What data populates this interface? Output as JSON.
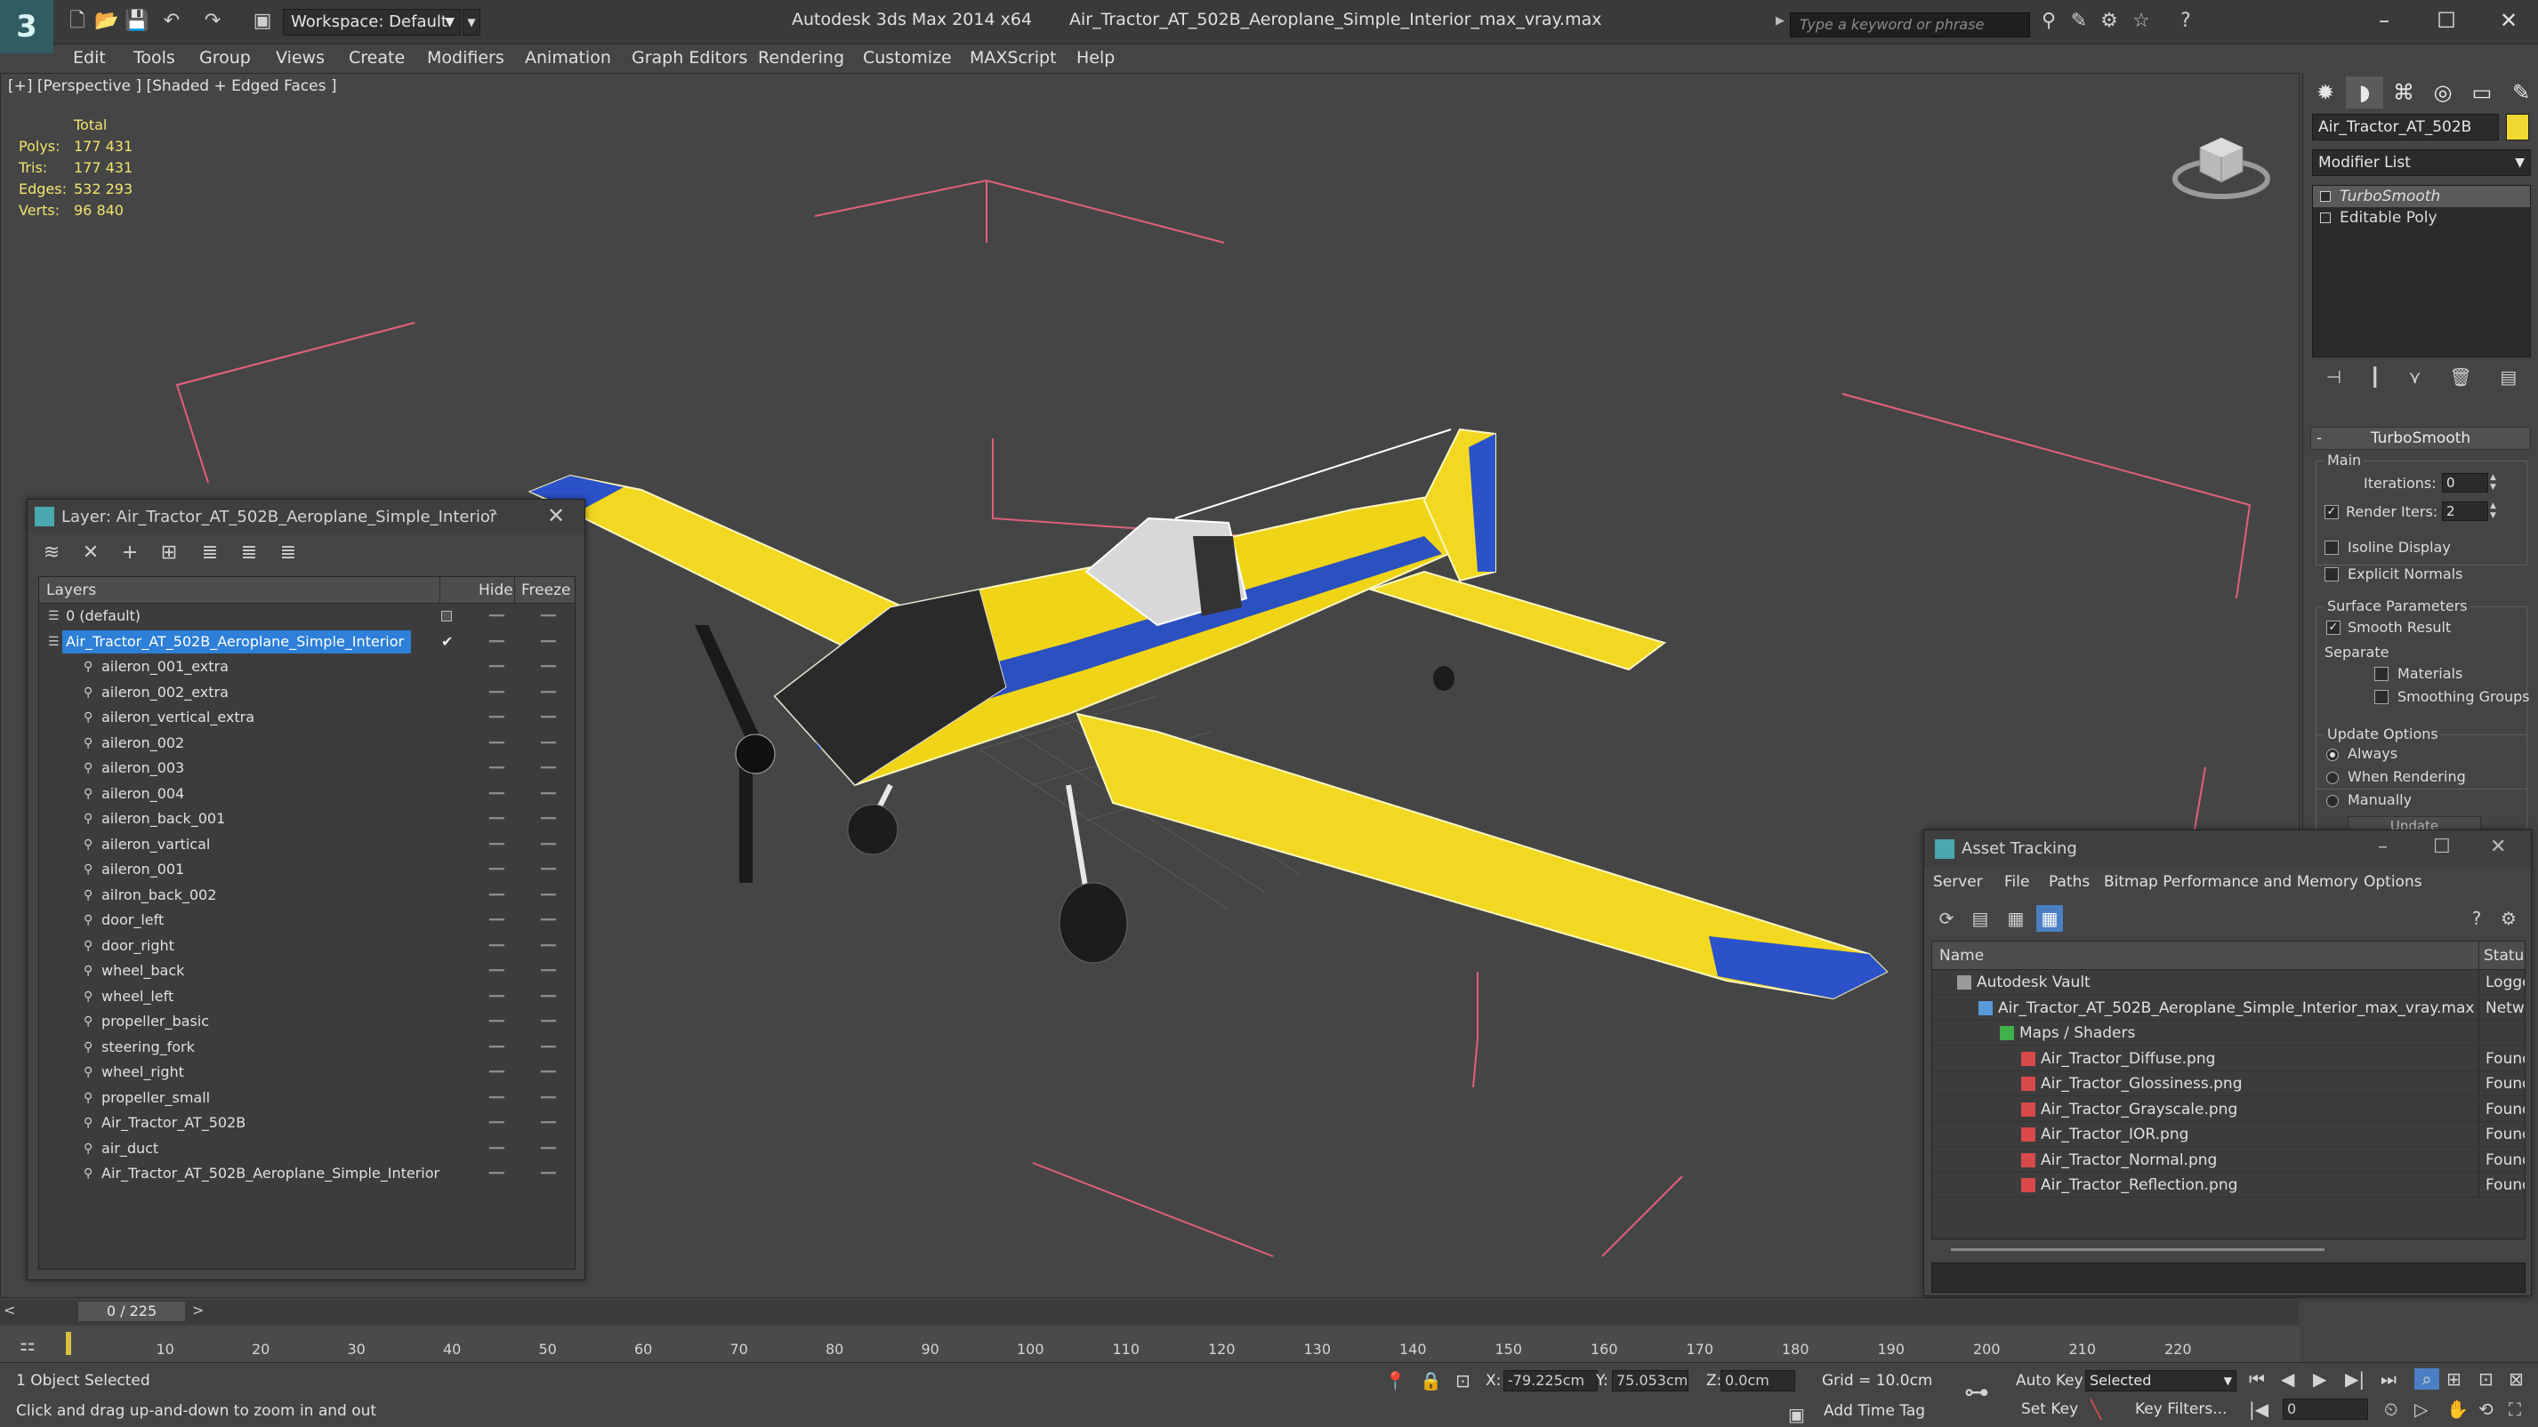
{
  "titlebar": {
    "workspace": "Workspace: Default",
    "app_name": "Autodesk 3ds Max  2014 x64",
    "file_name": "Air_Tractor_AT_502B_Aeroplane_Simple_Interior_max_vray.max",
    "search_placeholder": "Type a keyword or phrase"
  },
  "menu": [
    "Edit",
    "Tools",
    "Group",
    "Views",
    "Create",
    "Modifiers",
    "Animation",
    "Graph Editors",
    "Rendering",
    "Customize",
    "MAXScript",
    "Help"
  ],
  "viewport": {
    "label": "[+] [Perspective ] [Shaded + Edged Faces ]",
    "stats": {
      "header": "Total",
      "rows": [
        {
          "key": "Polys:",
          "value": "177 431"
        },
        {
          "key": "Tris:",
          "value": "177 431"
        },
        {
          "key": "Edges:",
          "value": "532 293"
        },
        {
          "key": "Verts:",
          "value": "96 840"
        }
      ]
    }
  },
  "command_panel": {
    "object_name": "Air_Tractor_AT_502B",
    "object_color": "#f0d830",
    "modifier_list": "Modifier List",
    "stack": [
      {
        "label": "TurboSmooth",
        "selected": true
      },
      {
        "label": "Editable Poly",
        "selected": false
      }
    ],
    "rollout_title": "TurboSmooth",
    "main_group": "Main",
    "iterations_label": "Iterations:",
    "iterations_value": "0",
    "render_iters_label": "Render Iters:",
    "render_iters_value": "2",
    "isoline_label": "Isoline Display",
    "explicit_normals_label": "Explicit Normals",
    "surface_params_label": "Surface Parameters",
    "smooth_result_label": "Smooth Result",
    "separate_label": "Separate",
    "materials_label": "Materials",
    "smoothing_groups_label": "Smoothing Groups",
    "update_options_label": "Update Options",
    "always_label": "Always",
    "when_rendering_label": "When Rendering",
    "manually_label": "Manually",
    "update_button": "Update"
  },
  "layer_dialog": {
    "title": "Layer: Air_Tractor_AT_502B_Aeroplane_Simple_Interior",
    "col_layers": "Layers",
    "col_hide": "Hide",
    "col_freeze": "Freeze",
    "layers": [
      {
        "name": "0 (default)",
        "level": 0,
        "selected": false
      },
      {
        "name": "Air_Tractor_AT_502B_Aeroplane_Simple_Interior",
        "level": 0,
        "selected": true
      },
      {
        "name": "aileron_001_extra",
        "level": 1
      },
      {
        "name": "aileron_002_extra",
        "level": 1
      },
      {
        "name": "aileron_vertical_extra",
        "level": 1
      },
      {
        "name": "aileron_002",
        "level": 1
      },
      {
        "name": "aileron_003",
        "level": 1
      },
      {
        "name": "aileron_004",
        "level": 1
      },
      {
        "name": "aileron_back_001",
        "level": 1
      },
      {
        "name": "aileron_vartical",
        "level": 1
      },
      {
        "name": "aileron_001",
        "level": 1
      },
      {
        "name": "ailron_back_002",
        "level": 1
      },
      {
        "name": "door_left",
        "level": 1
      },
      {
        "name": "door_right",
        "level": 1
      },
      {
        "name": "wheel_back",
        "level": 1
      },
      {
        "name": "wheel_left",
        "level": 1
      },
      {
        "name": "propeller_basic",
        "level": 1
      },
      {
        "name": "steering_fork",
        "level": 1
      },
      {
        "name": "wheel_right",
        "level": 1
      },
      {
        "name": "propeller_small",
        "level": 1
      },
      {
        "name": "Air_Tractor_AT_502B",
        "level": 1
      },
      {
        "name": "air_duct",
        "level": 1
      },
      {
        "name": "Air_Tractor_AT_502B_Aeroplane_Simple_Interior",
        "level": 1
      }
    ]
  },
  "asset_dialog": {
    "title": "Asset Tracking",
    "menu": [
      "Server",
      "File",
      "Paths",
      "Bitmap Performance and Memory",
      "Options"
    ],
    "col_name": "Name",
    "col_status": "Status",
    "rows": [
      {
        "name": "Autodesk Vault",
        "status": "Logged",
        "indent": 0,
        "icon": "vault-icon"
      },
      {
        "name": "Air_Tractor_AT_502B_Aeroplane_Simple_Interior_max_vray.max",
        "status": "Networ",
        "indent": 1,
        "icon": "max-file-icon"
      },
      {
        "name": "Maps / Shaders",
        "status": "",
        "indent": 2,
        "icon": "maps-icon"
      },
      {
        "name": "Air_Tractor_Diffuse.png",
        "status": "Found",
        "indent": 3,
        "icon": "png-icon"
      },
      {
        "name": "Air_Tractor_Glossiness.png",
        "status": "Found",
        "indent": 3,
        "icon": "png-icon"
      },
      {
        "name": "Air_Tractor_Grayscale.png",
        "status": "Found",
        "indent": 3,
        "icon": "png-icon"
      },
      {
        "name": "Air_Tractor_IOR.png",
        "status": "Found",
        "indent": 3,
        "icon": "png-icon"
      },
      {
        "name": "Air_Tractor_Normal.png",
        "status": "Found",
        "indent": 3,
        "icon": "png-icon"
      },
      {
        "name": "Air_Tractor_Reflection.png",
        "status": "Found",
        "indent": 3,
        "icon": "png-icon"
      }
    ]
  },
  "timeline": {
    "frame": "0 / 225",
    "ticks": [
      "10",
      "20",
      "30",
      "40",
      "50",
      "60",
      "70",
      "80",
      "90",
      "100",
      "110",
      "120",
      "130",
      "140",
      "150",
      "160",
      "170",
      "180",
      "190",
      "200",
      "210",
      "220"
    ]
  },
  "status": {
    "selection": "1 Object Selected",
    "prompt": "Click and drag up-and-down to zoom in and out",
    "x_label": "X:",
    "x_value": "-79.225cm",
    "y_label": "Y:",
    "y_value": "75.053cm",
    "z_label": "Z:",
    "z_value": "0.0cm",
    "grid": "Grid = 10.0cm",
    "add_time_tag": "Add Time Tag",
    "auto_key": "Auto Key",
    "set_key": "Set Key",
    "selected_dd": "Selected",
    "key_filters": "Key Filters...",
    "current_frame": "0"
  }
}
